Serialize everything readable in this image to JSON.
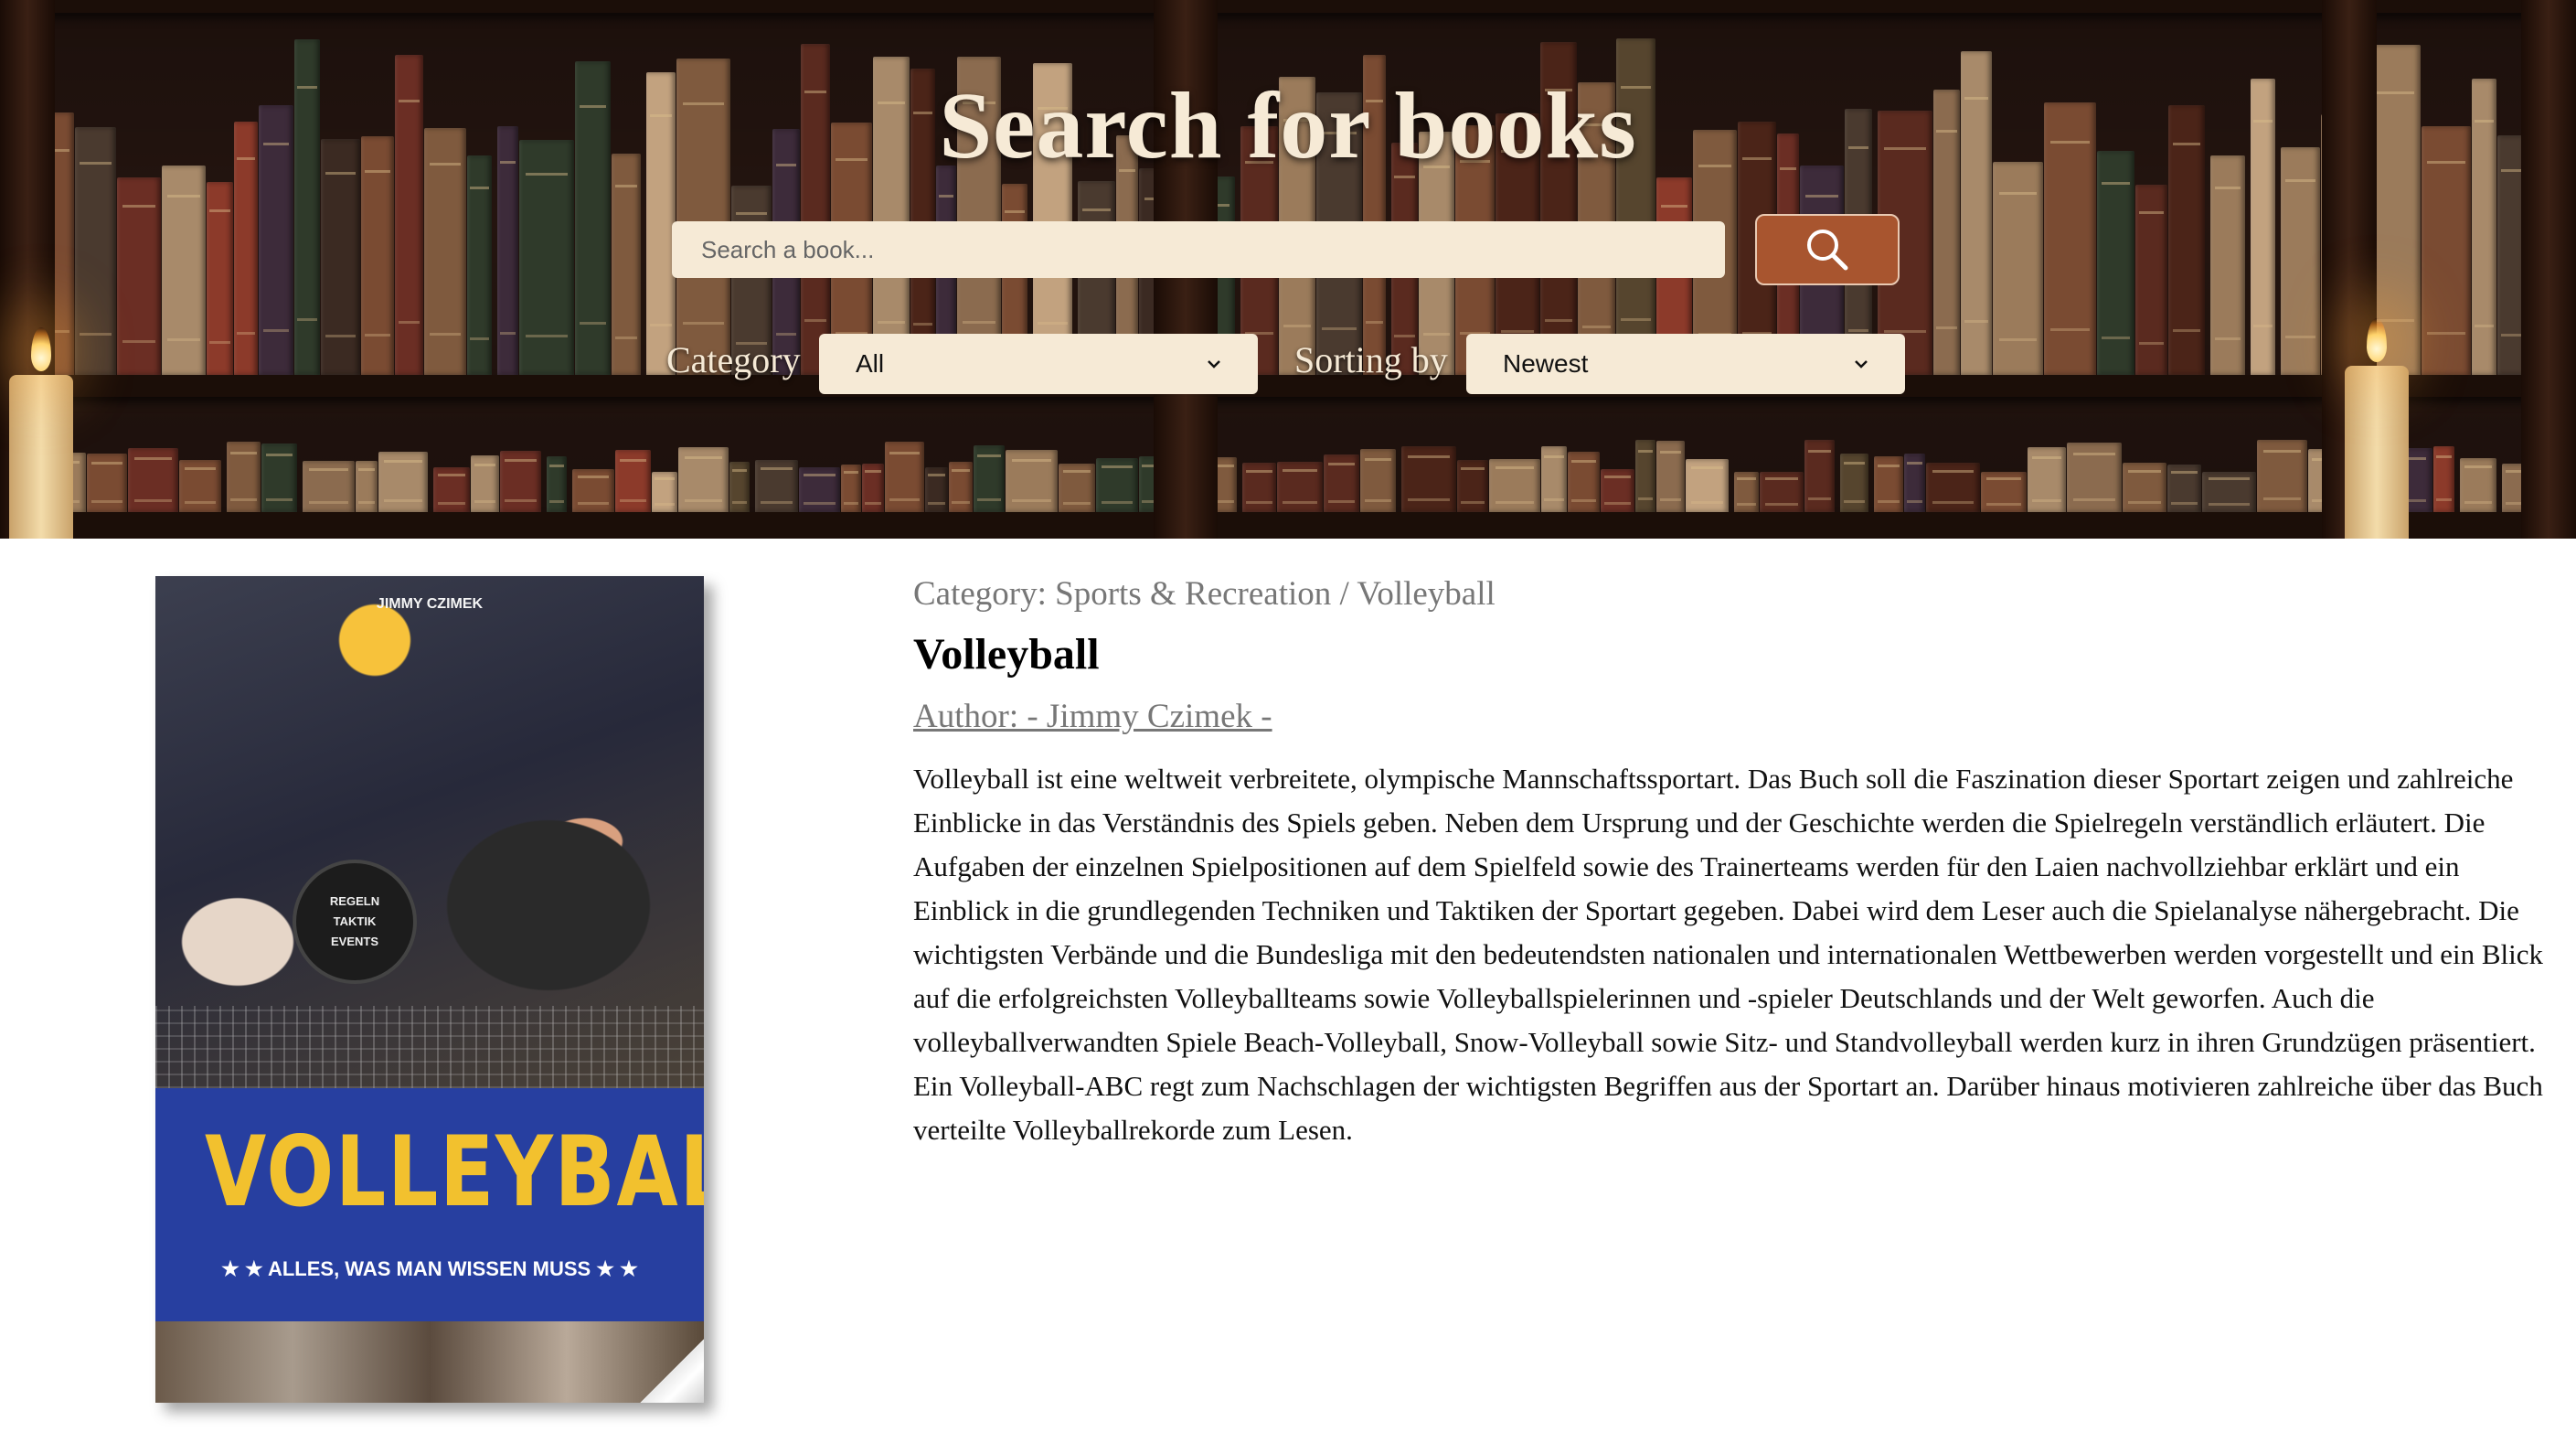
{
  "header": {
    "title": "Search for books",
    "search": {
      "placeholder": "Search a book...",
      "value": ""
    },
    "search_button_icon": "search-icon",
    "category_label": "Category",
    "category_selected": "All",
    "sorting_label": "Sorting by",
    "sorting_selected": "Newest"
  },
  "book": {
    "category": "Category: Sports & Recreation / Volleyball",
    "title": "Volleyball",
    "author": "Author: - Jimmy Czimek -",
    "description": "Volleyball ist eine weltweit verbreitete, olympische Mannschaftssportart. Das Buch soll die Faszination dieser Sportart zeigen und zahlreiche Einblicke in das Verständnis des Spiels geben. Neben dem Ursprung und der Geschichte werden die Spielregeln verständlich erläutert. Die Aufgaben der einzelnen Spielpositionen auf dem Spielfeld sowie des Trainerteams werden für den Laien nachvollziehbar erklärt und ein Einblick in die grundlegenden Techniken und Taktiken der Sportart gegeben. Dabei wird dem Leser auch die Spielanalyse nähergebracht. Die wichtigsten Verbände und die Bundesliga mit den bedeutendsten nationalen und internationalen Wettbewerben werden vorgestellt und ein Blick auf die erfolgreichsten Volleyballteams sowie Volleyballspielerinnen und -spieler Deutschlands und der Welt geworfen. Auch die volleyballverwandten Spiele Beach-Volleyball, Snow-Volleyball sowie Sitz- und Standvolleyball werden kurz in ihren Grundzügen präsentiert. Ein Volleyball-ABC regt zum Nachschlagen der wichtigsten Begriffen aus der Sportart an. Darüber hinaus motivieren zahlreiche über das Buch verteilte Volleyballrekorde zum Lesen.",
    "cover": {
      "author": "JIMMY CZIMEK",
      "badge": [
        "REGELN",
        "TAKTIK",
        "EVENTS"
      ],
      "title": "VOLLEYBALL",
      "subtitle": "★ ★ ALLES, WAS MAN WISSEN MUSS ★ ★"
    }
  },
  "colors": {
    "accent_button": "#a8552f",
    "input_background": "#f6ead6",
    "header_text": "#f6ead6",
    "muted_text": "#777777"
  }
}
